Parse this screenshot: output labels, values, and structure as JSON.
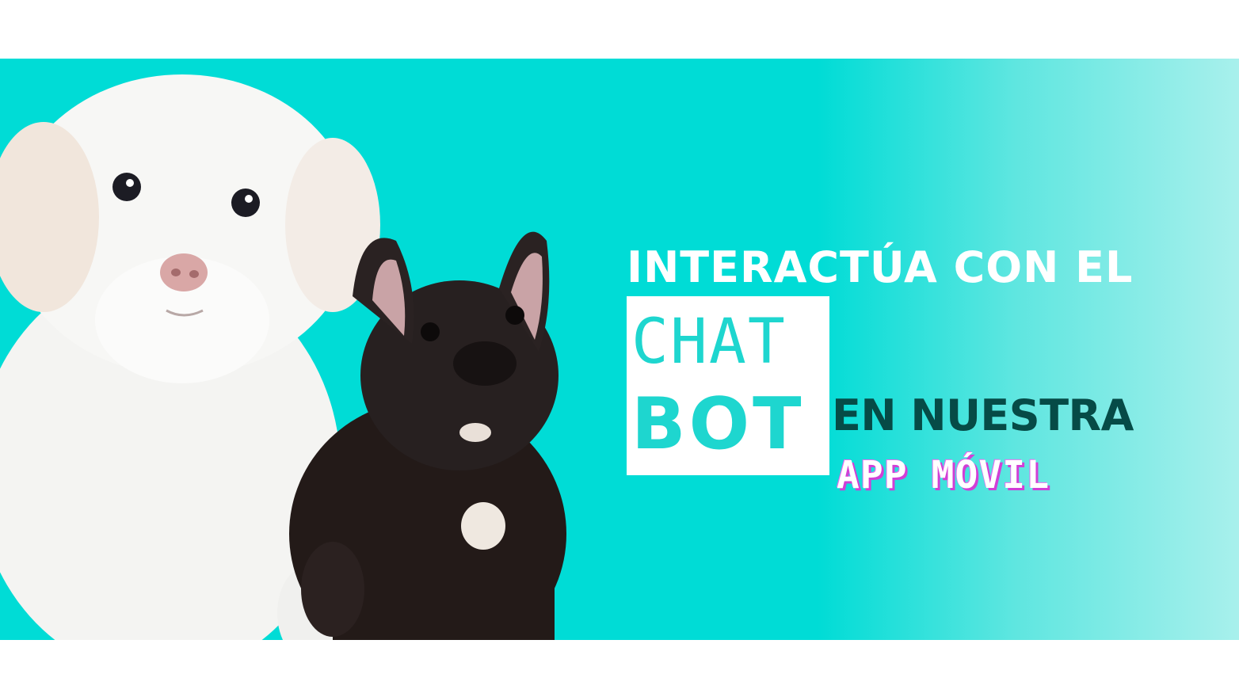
{
  "banner": {
    "headline_top": "INTERACTÚA CON EL",
    "chatbot_line1": "CHAT",
    "chatbot_line2": "BOT",
    "headline_mid": "EN NUESTRA",
    "headline_app": "APP MÓVIL"
  },
  "colors": {
    "background": "#00dcd6",
    "accent_text": "#1ed6cf",
    "dark_text": "#064b47",
    "magenta_shadow": "#d13fd6"
  },
  "images": {
    "left": "white-puppy",
    "right": "black-french-bulldog-puppy"
  }
}
